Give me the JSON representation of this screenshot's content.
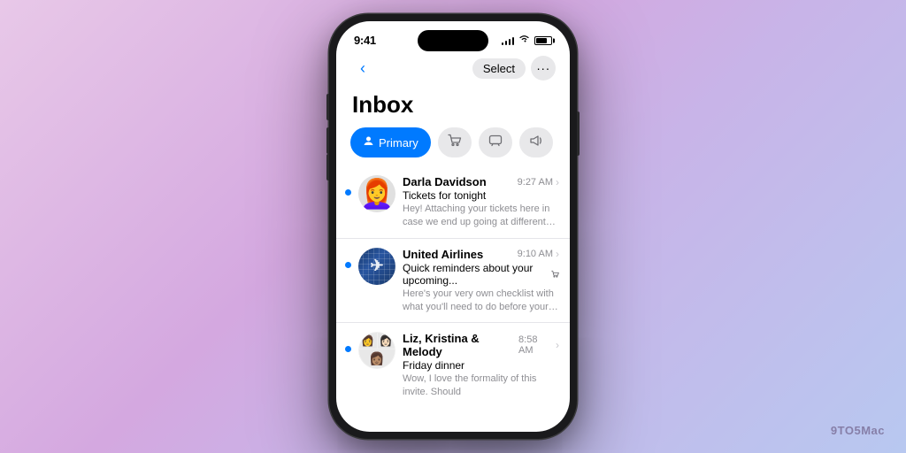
{
  "background": {
    "gradient": "135deg, #e8c8e8, #d4a8e0, #c8b4e8, #b8c8f0"
  },
  "watermark": "9TO5Mac",
  "status_bar": {
    "time": "9:41",
    "signal_label": "signal",
    "wifi_label": "wifi",
    "battery_label": "battery"
  },
  "nav": {
    "back_label": "‹",
    "select_label": "Select",
    "more_label": "···"
  },
  "inbox": {
    "title": "Inbox"
  },
  "filter_tabs": [
    {
      "id": "primary",
      "label": "Primary",
      "icon": "person",
      "active": true
    },
    {
      "id": "shopping",
      "label": "Shopping",
      "icon": "cart",
      "active": false
    },
    {
      "id": "messages",
      "label": "Messages",
      "icon": "message",
      "active": false
    },
    {
      "id": "promos",
      "label": "Promotions",
      "icon": "megaphone",
      "active": false
    }
  ],
  "emails": [
    {
      "id": 1,
      "sender": "Darla Davidson",
      "time": "9:27 AM",
      "subject": "Tickets for tonight",
      "preview": "Hey! Attaching your tickets here in case we end up going at different times. Can't wait!",
      "unread": true,
      "avatar_type": "emoji",
      "avatar_emoji": "👩"
    },
    {
      "id": 2,
      "sender": "United Airlines",
      "time": "9:10 AM",
      "subject": "Quick reminders about your upcoming...",
      "preview": "Here's your very own checklist with what you'll need to do before your flight and wh...",
      "unread": true,
      "avatar_type": "ua",
      "has_cart": true
    },
    {
      "id": 3,
      "sender": "Liz, Kristina & Melody",
      "time": "8:58 AM",
      "subject": "Friday dinner",
      "preview": "Wow, I love the formality of this invite. Should",
      "unread": true,
      "avatar_type": "multi"
    }
  ]
}
